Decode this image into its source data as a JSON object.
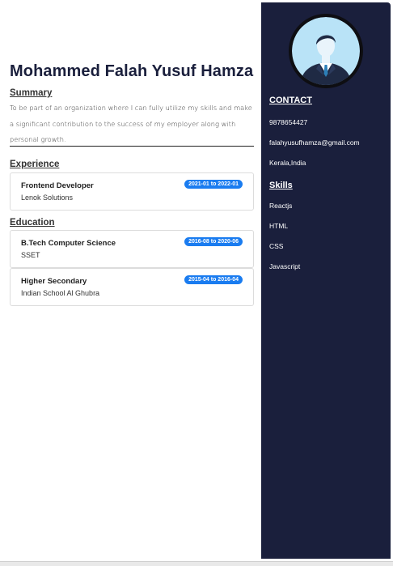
{
  "profile": {
    "name": "Mohammed Falah Yusuf Hamza"
  },
  "summary": {
    "heading": "Summary",
    "text": "To be part of an organization where I can fully utilize my skills and make a significant contribution to the success of my employer along with personal growth."
  },
  "experience": {
    "heading": "Experience",
    "items": [
      {
        "title": "Frontend Developer",
        "company": "Lenok Solutions",
        "dates": "2021-01 to 2022-01"
      }
    ]
  },
  "education": {
    "heading": "Education",
    "items": [
      {
        "title": "B.Tech Computer Science",
        "institution": "SSET",
        "dates": "2016-08 to 2020-06"
      },
      {
        "title": "Higher Secondary",
        "institution": "Indian School Al Ghubra",
        "dates": "2015-04 to 2016-04"
      }
    ]
  },
  "contact": {
    "heading": "CONTACT",
    "phone": "9878654427",
    "email": "falahyusufhamza@gmail.com",
    "location": "Kerala,India"
  },
  "skills": {
    "heading": "Skills",
    "items": [
      "Reactjs",
      "HTML",
      "CSS",
      "Javascript"
    ]
  },
  "icons": {
    "avatar": "person-avatar-icon"
  },
  "colors": {
    "sidebar_bg": "#1a1f3c",
    "badge_bg": "#1a7cf0",
    "avatar_bg": "#b9e3f7"
  }
}
